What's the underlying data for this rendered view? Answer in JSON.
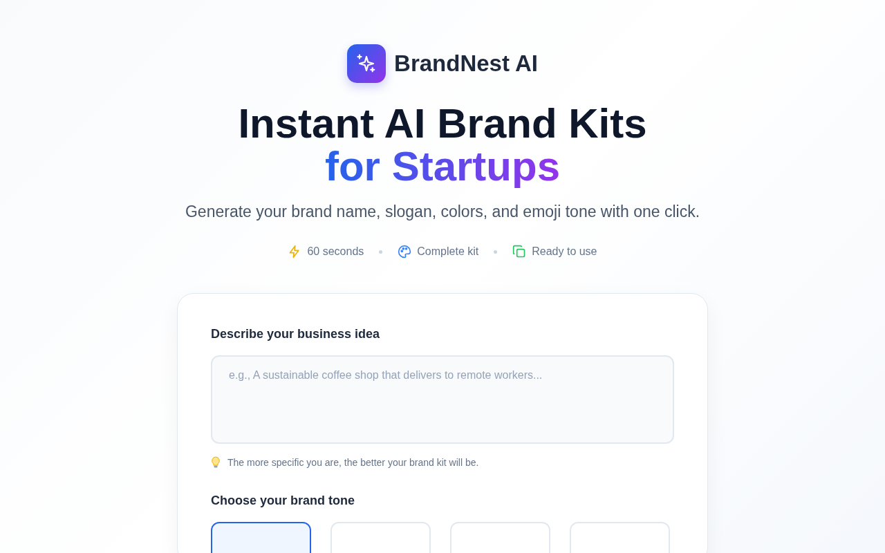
{
  "brand": {
    "name": "BrandNest AI"
  },
  "hero": {
    "title_line_1": "Instant AI Brand Kits",
    "title_line_2": "for Startups",
    "subtitle": "Generate your brand name, slogan, colors, and emoji tone with one click."
  },
  "features": [
    {
      "kind": "speed",
      "label": "60 seconds"
    },
    {
      "kind": "palette",
      "label": "Complete kit"
    },
    {
      "kind": "copy",
      "label": "Ready to use"
    }
  ],
  "form": {
    "idea_label": "Describe your business idea",
    "idea_placeholder": "e.g., A sustainable coffee shop that delivers to remote workers...",
    "hint": "The more specific you are, the better your brand kit will be.",
    "tone_label": "Choose your brand tone",
    "tones": [
      {
        "selected": true
      },
      {
        "selected": false
      },
      {
        "selected": false
      },
      {
        "selected": false
      }
    ]
  }
}
